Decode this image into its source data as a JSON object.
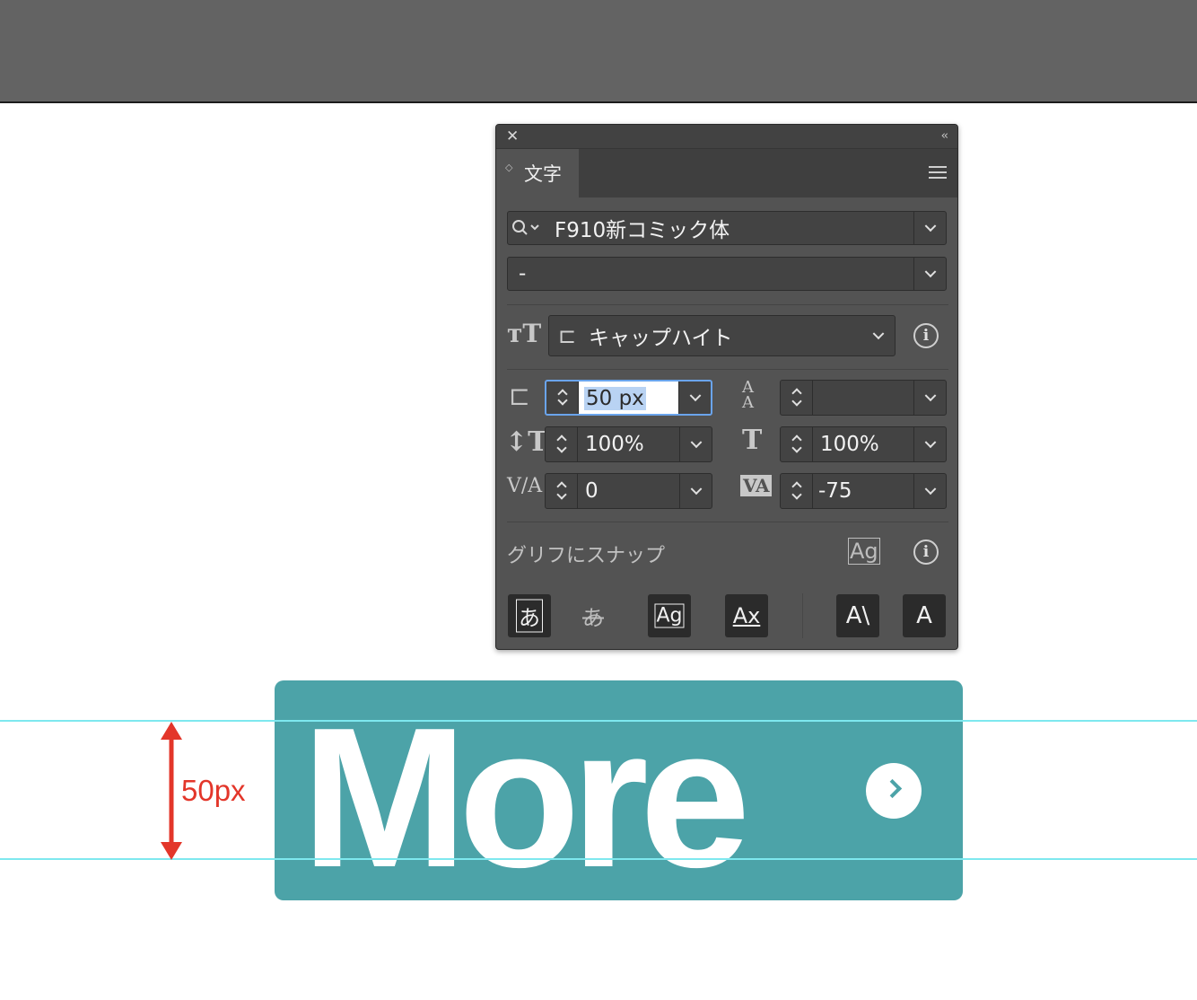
{
  "panel": {
    "tab_label": "文字",
    "font_family": "F910新コミック体",
    "font_style": "-",
    "size_reference": "キャップハイト",
    "font_size": "50 px",
    "leading": "",
    "vertical_scale": "100%",
    "horizontal_scale": "100%",
    "kerning": "0",
    "tracking": "-75",
    "snap_to_glyph_label": "グリフにスナップ",
    "buttons": {
      "kana_box": "あ",
      "kana_strike": "あ",
      "ag_box": "Ag",
      "ax_under": "Ax",
      "a_slant": "A\\",
      "a_corner": "A"
    }
  },
  "canvas": {
    "button_text": "More",
    "measure_label": "50px",
    "colors": {
      "button": "#4ca3a8",
      "guide": "#7ee8ef",
      "measure": "#e3362a"
    }
  }
}
